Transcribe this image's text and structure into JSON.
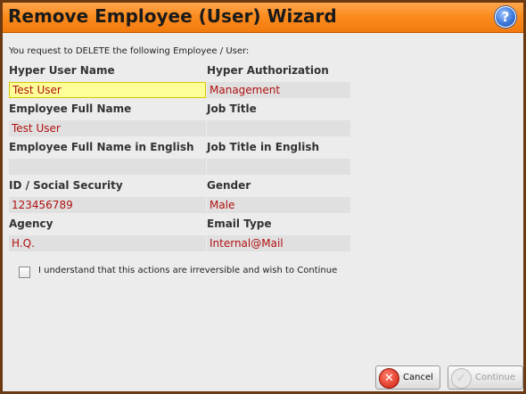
{
  "window": {
    "title": "Remove Employee (User) Wizard",
    "help_glyph": "?"
  },
  "intro": "You request to DELETE the following Employee / User:",
  "fields": {
    "hyper_user_name": {
      "label": "Hyper User Name",
      "value": "Test User"
    },
    "hyper_authorization": {
      "label": "Hyper Authorization",
      "value": "Management"
    },
    "employee_full_name": {
      "label": "Employee Full Name",
      "value": "Test User"
    },
    "job_title": {
      "label": "Job Title",
      "value": ""
    },
    "employee_full_name_english": {
      "label": "Employee Full Name in English",
      "value": ""
    },
    "job_title_english": {
      "label": "Job Title in English",
      "value": ""
    },
    "id_social_security": {
      "label": "ID / Social Security",
      "value": "123456789"
    },
    "gender": {
      "label": "Gender",
      "value": "Male"
    },
    "agency": {
      "label": "Agency",
      "value": "H.Q."
    },
    "email_type": {
      "label": "Email Type",
      "value": "Internal@Mail"
    }
  },
  "confirm": {
    "label": "I understand that this actions are irreversible and wish to Continue",
    "checked": false
  },
  "buttons": {
    "cancel": "Cancel",
    "continue": "Continue"
  },
  "colors": {
    "title_bar": "#fb8c1f",
    "value_text": "#b01010",
    "highlight_field": "#ffff99"
  }
}
